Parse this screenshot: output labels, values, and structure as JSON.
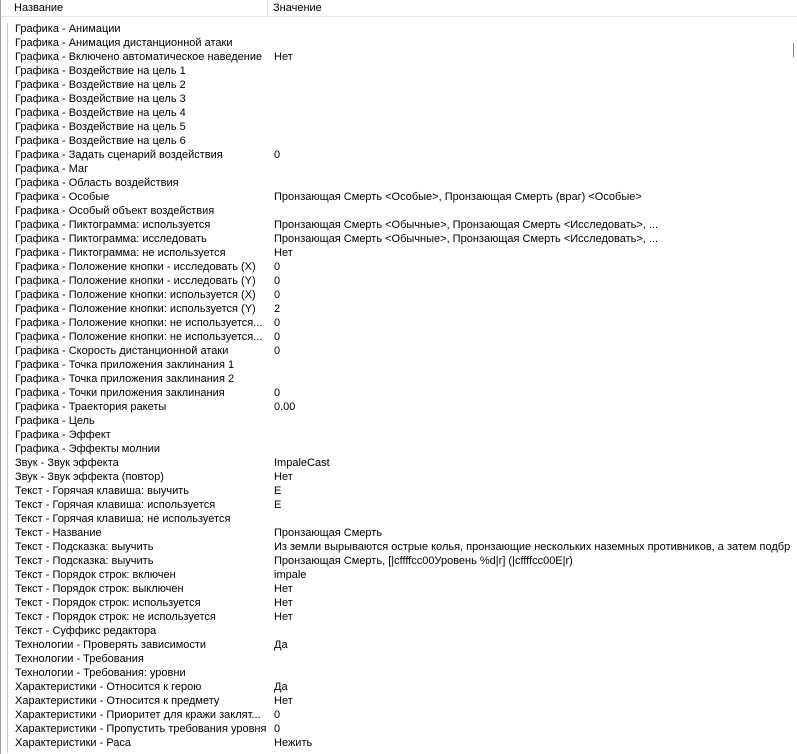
{
  "columns": {
    "name": "Название",
    "value": "Значение"
  },
  "rows": [
    {
      "name": "Графика - Анимации",
      "value": ""
    },
    {
      "name": "Графика - Анимация дистанционной атаки",
      "value": ""
    },
    {
      "name": "Графика - Включено автоматическое наведение",
      "value": "Нет"
    },
    {
      "name": "Графика - Воздействие на цель 1",
      "value": ""
    },
    {
      "name": "Графика - Воздействие на цель 2",
      "value": ""
    },
    {
      "name": "Графика - Воздействие на цель 3",
      "value": ""
    },
    {
      "name": "Графика - Воздействие на цель 4",
      "value": ""
    },
    {
      "name": "Графика - Воздействие на цель 5",
      "value": ""
    },
    {
      "name": "Графика - Воздействие на цель 6",
      "value": ""
    },
    {
      "name": "Графика - Задать сценарий воздействия",
      "value": "0"
    },
    {
      "name": "Графика - Маг",
      "value": ""
    },
    {
      "name": "Графика - Область воздействия",
      "value": ""
    },
    {
      "name": "Графика - Особые",
      "value": "Пронзающая Смерть <Особые>, Пронзающая Смерть (враг) <Особые>"
    },
    {
      "name": "Графика - Особый объект воздействия",
      "value": ""
    },
    {
      "name": "Графика - Пиктограмма: используется",
      "value": "Пронзающая Смерть <Обычные>, Пронзающая Смерть <Исследовать>, ..."
    },
    {
      "name": "Графика - Пиктограмма: исследовать",
      "value": "Пронзающая Смерть <Обычные>, Пронзающая Смерть <Исследовать>, ..."
    },
    {
      "name": "Графика - Пиктограмма: не используется",
      "value": "Нет"
    },
    {
      "name": "Графика - Положение кнопки - исследовать (X)",
      "value": "0"
    },
    {
      "name": "Графика - Положение кнопки - исследовать (Y)",
      "value": "0"
    },
    {
      "name": "Графика - Положение кнопки: используется (X)",
      "value": "0"
    },
    {
      "name": "Графика - Положение кнопки: используется (Y)",
      "value": "2"
    },
    {
      "name": "Графика - Положение кнопки: не используется...",
      "value": "0"
    },
    {
      "name": "Графика - Положение кнопки: не используется...",
      "value": "0"
    },
    {
      "name": "Графика - Скорость дистанционной атаки",
      "value": "0"
    },
    {
      "name": "Графика - Точка приложения заклинания 1",
      "value": ""
    },
    {
      "name": "Графика - Точка приложения заклинания 2",
      "value": ""
    },
    {
      "name": "Графика - Точки приложения заклинания",
      "value": "0"
    },
    {
      "name": "Графика - Траектория ракеты",
      "value": "0.00"
    },
    {
      "name": "Графика - Цель",
      "value": ""
    },
    {
      "name": "Графика - Эффект",
      "value": ""
    },
    {
      "name": "Графика - Эффекты молнии",
      "value": ""
    },
    {
      "name": "Звук - Звук эффекта",
      "value": "ImpaleCast"
    },
    {
      "name": "Звук - Звук эффекта (повтор)",
      "value": "Нет"
    },
    {
      "name": "Текст - Горячая клавиша: выучить",
      "value": "E"
    },
    {
      "name": "Текст - Горячая клавиша: используется",
      "value": "E"
    },
    {
      "name": "Текст - Горячая клавиша: не используется",
      "value": ""
    },
    {
      "name": "Текст - Название",
      "value": "Пронзающая Смерть"
    },
    {
      "name": "Текст - Подсказка: выучить",
      "value": "Из земли вырываются острые колья, пронзающие нескольких наземных противников, а затем подбр"
    },
    {
      "name": "Текст - Подсказка: выучить",
      "value": "Пронзающая Смерть, [|cffffcc00Уровень %d|r] (|cffffcc00E|r)"
    },
    {
      "name": "Текст - Порядок строк: включен",
      "value": "impale"
    },
    {
      "name": "Текст - Порядок строк: выключен",
      "value": "Нет"
    },
    {
      "name": "Текст - Порядок строк: используется",
      "value": "Нет"
    },
    {
      "name": "Текст - Порядок строк: не используется",
      "value": "Нет"
    },
    {
      "name": "Текст - Суффикс редактора",
      "value": ""
    },
    {
      "name": "Технологии - Проверять зависимости",
      "value": "Да"
    },
    {
      "name": "Технологии - Требования",
      "value": ""
    },
    {
      "name": "Технологии - Требования: уровни",
      "value": ""
    },
    {
      "name": "Характеристики - Относится к герою",
      "value": "Да"
    },
    {
      "name": "Характеристики - Относится к предмету",
      "value": "Нет"
    },
    {
      "name": "Характеристики - Приоритет для кражи заклят...",
      "value": "0"
    },
    {
      "name": "Характеристики - Пропустить требования уровня",
      "value": "0"
    },
    {
      "name": "Характеристики - Раса",
      "value": "Нежить"
    }
  ]
}
